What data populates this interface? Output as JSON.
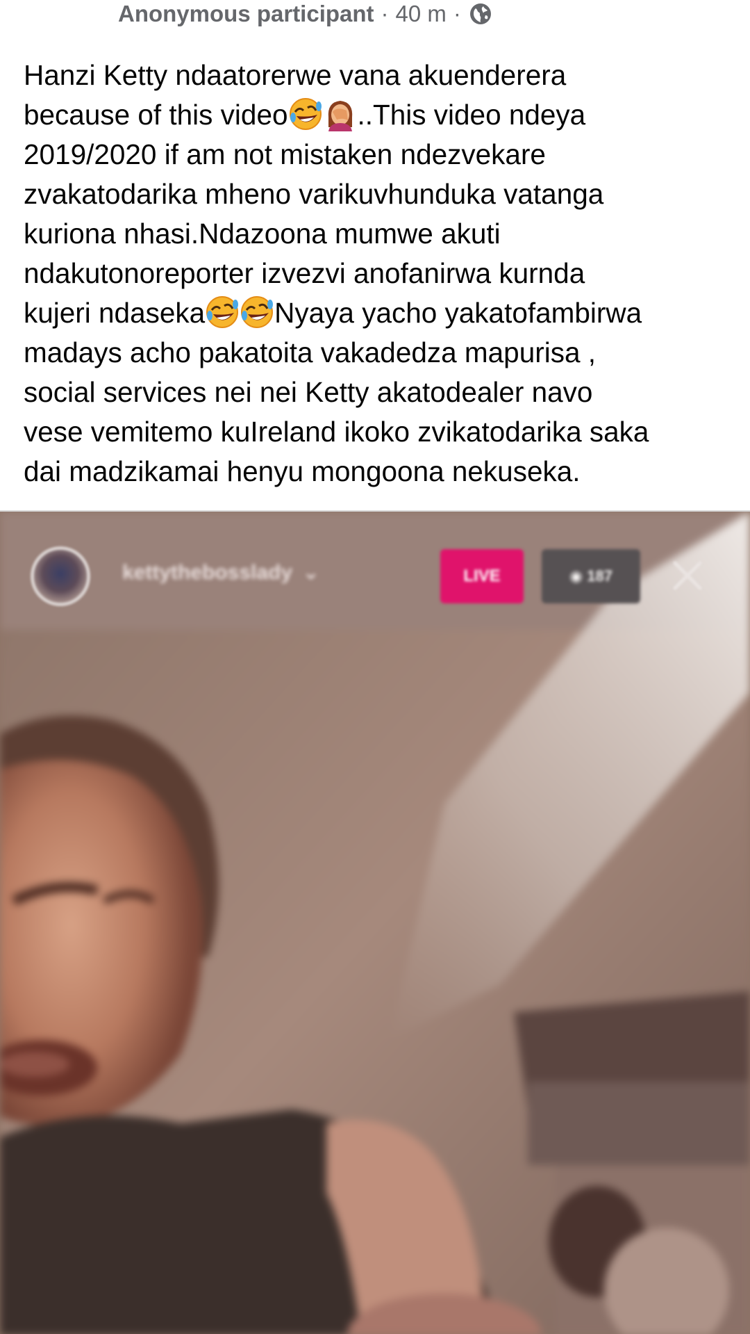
{
  "post": {
    "author": "Anonymous participant",
    "separator": "·",
    "time": "40 m",
    "audience_icon": "globe-icon",
    "body_lines": [
      {
        "parts": [
          "Hanzi Ketty ndaatorerwe vana akuenderera"
        ]
      },
      {
        "parts": [
          "because of this video",
          "..This video ndeya"
        ],
        "emojis": [
          "rofl-emoji",
          "facepalm-emoji"
        ]
      },
      {
        "parts": [
          "2019/2020 if am not mistaken ndezvekare"
        ]
      },
      {
        "parts": [
          "zvakatodarika mheno varikuvhunduka vatanga"
        ]
      },
      {
        "parts": [
          "kuriona nhasi.Ndazoona mumwe akuti"
        ]
      },
      {
        "parts": [
          "ndakutonoreporter izvezvi anofanirwa kurnda"
        ]
      },
      {
        "parts": [
          "kujeri ndaseka",
          "Nyaya yacho yakatofambirwa"
        ],
        "emojis": [
          "rofl-emoji",
          "rofl-emoji"
        ]
      },
      {
        "parts": [
          "madays acho pakatoita vakadedza mapurisa ,"
        ]
      },
      {
        "parts": [
          "social services nei nei Ketty  akatodealer navo"
        ]
      },
      {
        "parts": [
          "vese vemitemo kuIreland ikoko zvikatodarika saka"
        ]
      },
      {
        "parts": [
          "dai madzikamai henyu mongoona nekuseka."
        ]
      }
    ]
  },
  "video": {
    "streamer_name": "kettytheboss​lady",
    "dropdown_glyph": "⌄",
    "live_label": "LIVE",
    "viewer_label": "◉ 187"
  },
  "colors": {
    "text": "#050505",
    "meta": "#65676b",
    "live": "#e0136b",
    "brand": "#1877f2"
  }
}
